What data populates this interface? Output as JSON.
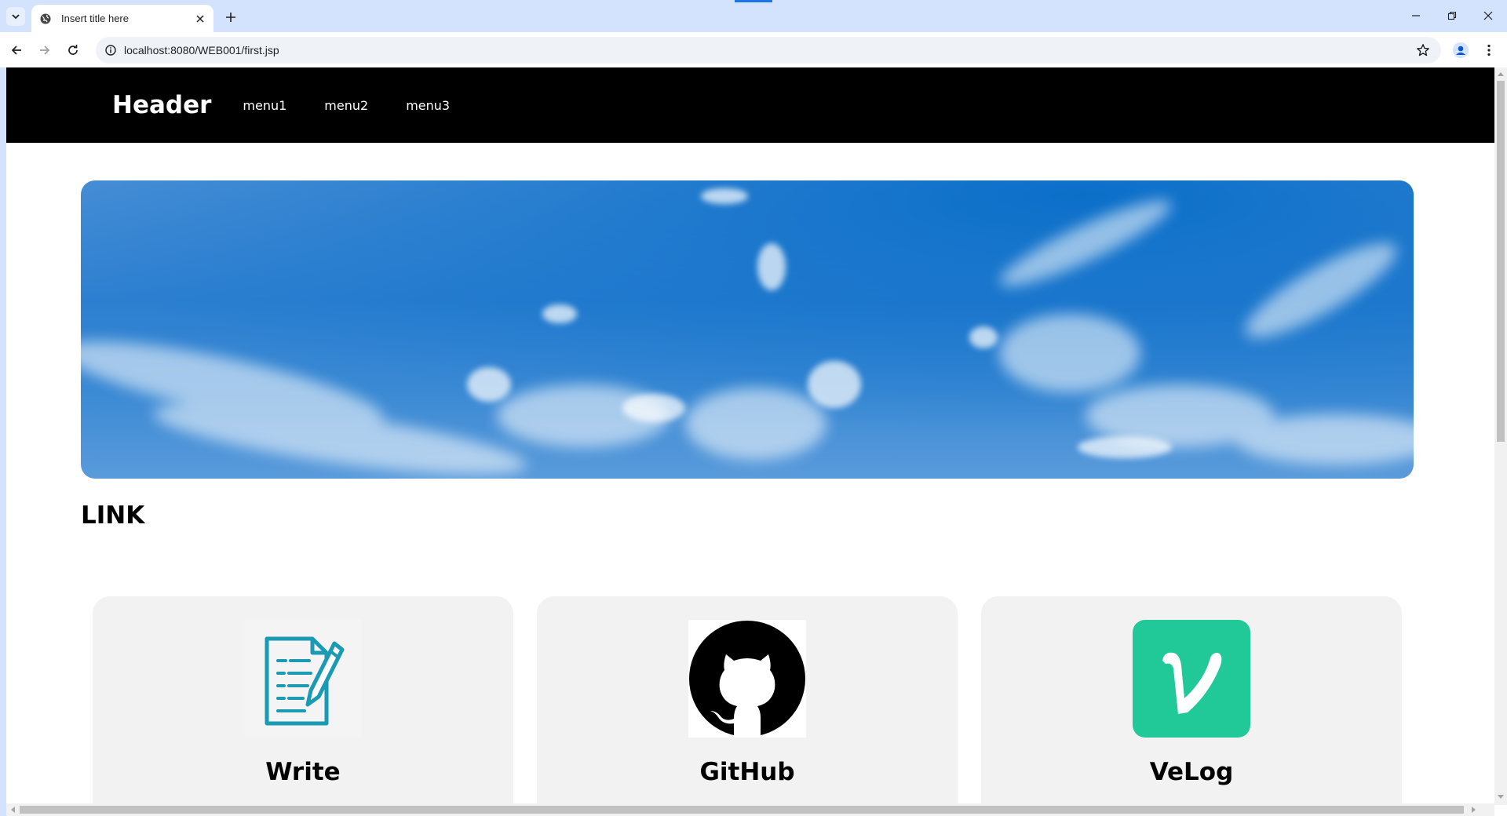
{
  "browser": {
    "tab_title": "Insert title here",
    "url": "localhost:8080/WEB001/first.jsp"
  },
  "site": {
    "logo": "Header",
    "nav": [
      "menu1",
      "menu2",
      "menu3"
    ],
    "section_title": "LINK",
    "cards": [
      {
        "label": "Write",
        "icon": "document-pen-icon"
      },
      {
        "label": "GitHub",
        "icon": "github-icon"
      },
      {
        "label": "VeLog",
        "icon": "velog-icon"
      }
    ]
  },
  "colors": {
    "header_bg": "#000000",
    "card_bg": "#f2f2f2",
    "write_icon": "#1a9ab3",
    "velog_icon_bg": "#20c997"
  }
}
